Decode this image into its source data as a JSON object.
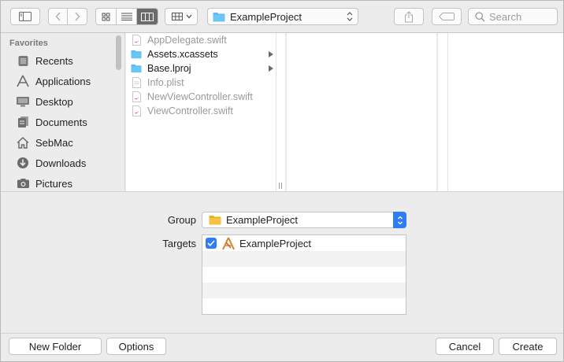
{
  "toolbar": {
    "path_label": "ExampleProject",
    "search_placeholder": "Search"
  },
  "sidebar": {
    "section_title": "Favorites",
    "items": [
      {
        "label": "Recents",
        "icon": "recents-icon"
      },
      {
        "label": "Applications",
        "icon": "applications-icon"
      },
      {
        "label": "Desktop",
        "icon": "desktop-icon"
      },
      {
        "label": "Documents",
        "icon": "documents-icon"
      },
      {
        "label": "SebMac",
        "icon": "home-icon"
      },
      {
        "label": "Downloads",
        "icon": "downloads-icon"
      },
      {
        "label": "Pictures",
        "icon": "pictures-icon"
      }
    ]
  },
  "files": [
    {
      "name": "AppDelegate.swift",
      "kind": "swift",
      "enabled": false
    },
    {
      "name": "Assets.xcassets",
      "kind": "folder",
      "enabled": true
    },
    {
      "name": "Base.lproj",
      "kind": "folder",
      "enabled": true
    },
    {
      "name": "Info.plist",
      "kind": "plist",
      "enabled": false
    },
    {
      "name": "NewViewController.swift",
      "kind": "swift",
      "enabled": false
    },
    {
      "name": "ViewController.swift",
      "kind": "swift",
      "enabled": false
    }
  ],
  "options": {
    "group_label": "Group",
    "group_value": "ExampleProject",
    "targets_label": "Targets",
    "targets": [
      {
        "name": "ExampleProject",
        "checked": true
      }
    ]
  },
  "buttons": {
    "new_folder": "New Folder",
    "options": "Options",
    "cancel": "Cancel",
    "create": "Create"
  },
  "colors": {
    "accent": "#2f7df6",
    "folder": "#5ebbf0",
    "group_folder": "#f5c242",
    "window_bg": "#ececec"
  }
}
